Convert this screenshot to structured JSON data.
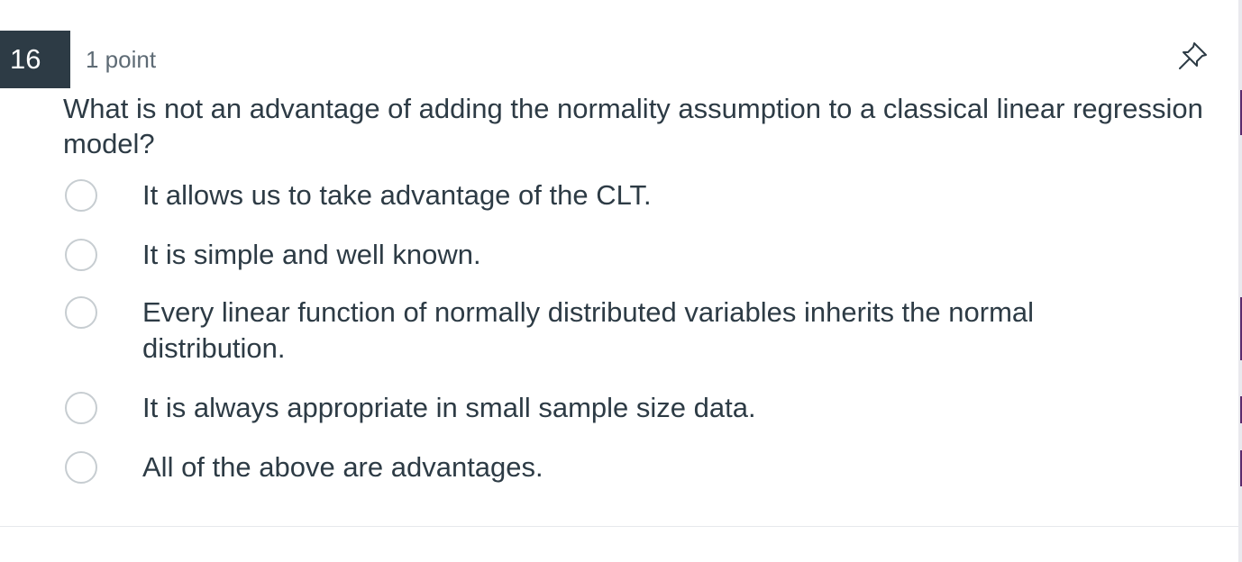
{
  "question": {
    "number": "16",
    "points": "1 point",
    "text_lines": [
      "What is not an advantage of adding the normality assumption to a classical linear regression",
      "model?"
    ]
  },
  "options": [
    {
      "lines": [
        "It allows us to take advantage of the CLT."
      ],
      "selected": false
    },
    {
      "lines": [
        "It is simple and well known."
      ],
      "selected": false
    },
    {
      "lines": [
        "Every linear function of normally distributed variables inherits the normal",
        "distribution."
      ],
      "selected": false
    },
    {
      "lines": [
        "It is always appropriate in small sample size data."
      ],
      "selected": false
    },
    {
      "lines": [
        "All of the above are advantages."
      ],
      "selected": false
    }
  ],
  "icons": {
    "pin": "pin-icon",
    "radio": "radio-button-unchecked-icon"
  },
  "colors": {
    "number_badge_bg": "#2d3b45",
    "text": "#2d3b45",
    "muted": "#5e6b75",
    "radio_border": "#c7cdd1",
    "edge_accent": "#5b2b6e"
  }
}
